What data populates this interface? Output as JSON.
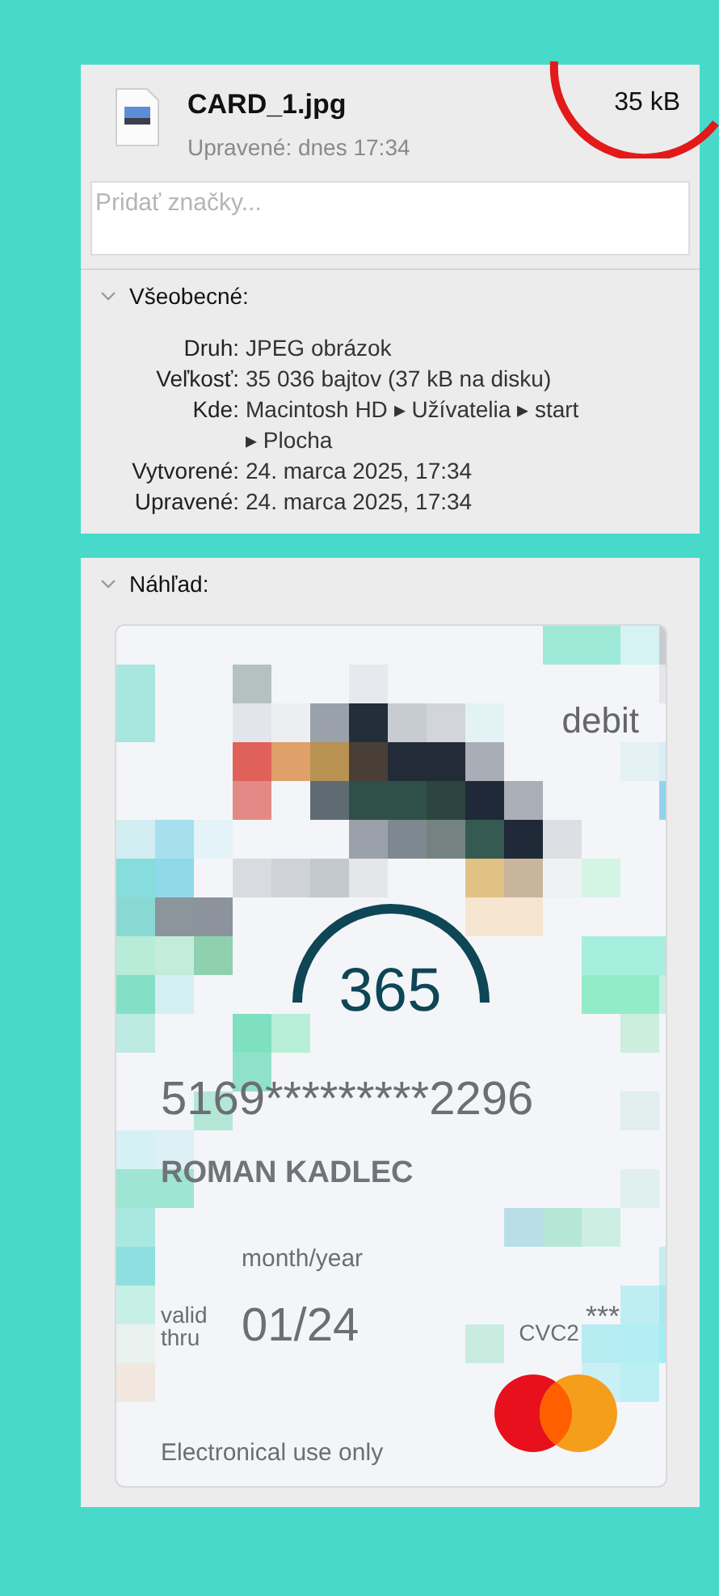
{
  "file": {
    "name": "CARD_1.jpg",
    "size": "35 kB",
    "modified": "Upravené: dnes 17:34"
  },
  "tags": {
    "placeholder": "Pridať značky..."
  },
  "general": {
    "title": "Všeobecné:",
    "expanded": true,
    "rows": [
      {
        "label": "Druh:",
        "value": "JPEG obrázok"
      },
      {
        "label": "Veľkosť:",
        "value": "35 036 bajtov (37 kB na disku)"
      },
      {
        "label": "Kde:",
        "value": "Macintosh HD ▸ Užívatelia ▸ start ▸ Plocha"
      },
      {
        "label": "Vytvorené:",
        "value": "24. marca 2025, 17:34"
      },
      {
        "label": "Upravené:",
        "value": "24. marca 2025, 17:34"
      }
    ]
  },
  "preview": {
    "title": "Náhľad:",
    "expanded": true,
    "card": {
      "type": "debit",
      "logo": "365",
      "number": "5169*********2296",
      "holder": "ROMAN KADLEC",
      "expiry_caption": "month/year",
      "valid_label": "valid thru",
      "expiry": "01/24",
      "cvc_label": "CVC2",
      "cvc": "***",
      "footer": "Electronical use only"
    }
  }
}
